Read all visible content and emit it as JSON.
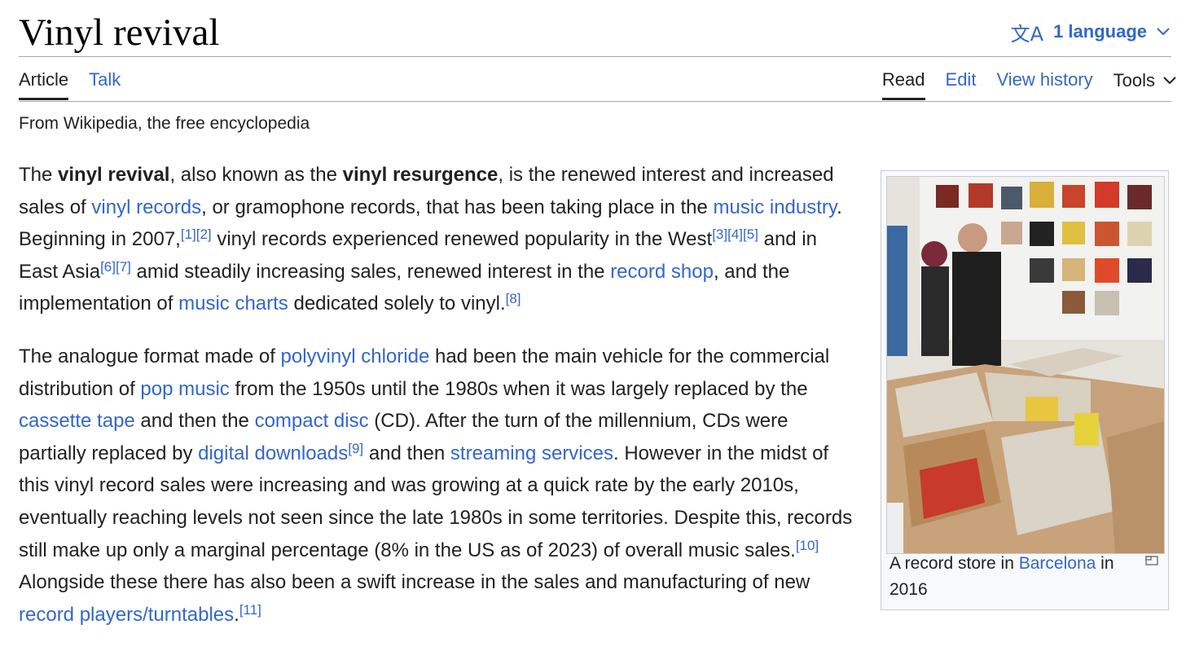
{
  "page": {
    "title": "Vinyl revival",
    "language_button": "1 language",
    "tagline": "From Wikipedia, the free encyclopedia"
  },
  "tabs": {
    "left": [
      "Article",
      "Talk"
    ],
    "right": [
      "Read",
      "Edit",
      "View history",
      "Tools"
    ]
  },
  "icons": [
    "translate-icon",
    "chevron-down-icon",
    "enlarge-icon"
  ],
  "colors": {
    "link": "#3366cc",
    "text": "#202122",
    "rule": "#a2a9b1"
  },
  "paragraph1": {
    "t1": "The ",
    "b1": "vinyl revival",
    "t2": ", also known as the ",
    "b2": "vinyl resurgence",
    "t3": ", is the renewed interest and increased sales of ",
    "l1": "vinyl records",
    "t4": ", or gramophone records, that has been taking place in the ",
    "l2": "music industry",
    "t5": ". Beginning in 2007,",
    "r1": "[1]",
    "r2": "[2]",
    "t6": " vinyl records experienced renewed popularity in the West",
    "r3": "[3]",
    "r4": "[4]",
    "r5": "[5]",
    "t7": " and in East Asia",
    "r6": "[6]",
    "r7": "[7]",
    "t8": " amid steadily increasing sales, renewed interest in the ",
    "l3": "record shop",
    "t9": ", and the implementation of ",
    "l4": "music charts",
    "t10": " dedicated solely to vinyl.",
    "r8": "[8]"
  },
  "paragraph2": {
    "t1": "The analogue format made of ",
    "l1": "polyvinyl chloride",
    "t2": " had been the main vehicle for the commercial distribution of ",
    "l2": "pop music",
    "t3": " from the 1950s until the 1980s when it was largely replaced by the ",
    "l3": "cassette tape",
    "t4": " and then the ",
    "l4": "compact disc",
    "t5": " (CD). After the turn of the millennium, CDs were partially replaced by ",
    "l5": "digital downloads",
    "r9": "[9]",
    "t6": " and then ",
    "l6": "streaming services",
    "t7": ". However in the midst of this vinyl record sales were increasing and was growing at a quick rate by the early 2010s, eventually reaching levels not seen since the late 1980s in some territories. Despite this, records still make up only a marginal percentage (8% in the US as of 2023) of overall music sales.",
    "r10": "[10]",
    "t8": " Alongside these there has also been a swift increase in the sales and manufacturing of new ",
    "l7": "record players/turntables",
    "t9": ".",
    "r11": "[11]"
  },
  "figure": {
    "caption_t1": "A record store in ",
    "caption_link": "Barcelona",
    "caption_t2": " in 2016"
  }
}
